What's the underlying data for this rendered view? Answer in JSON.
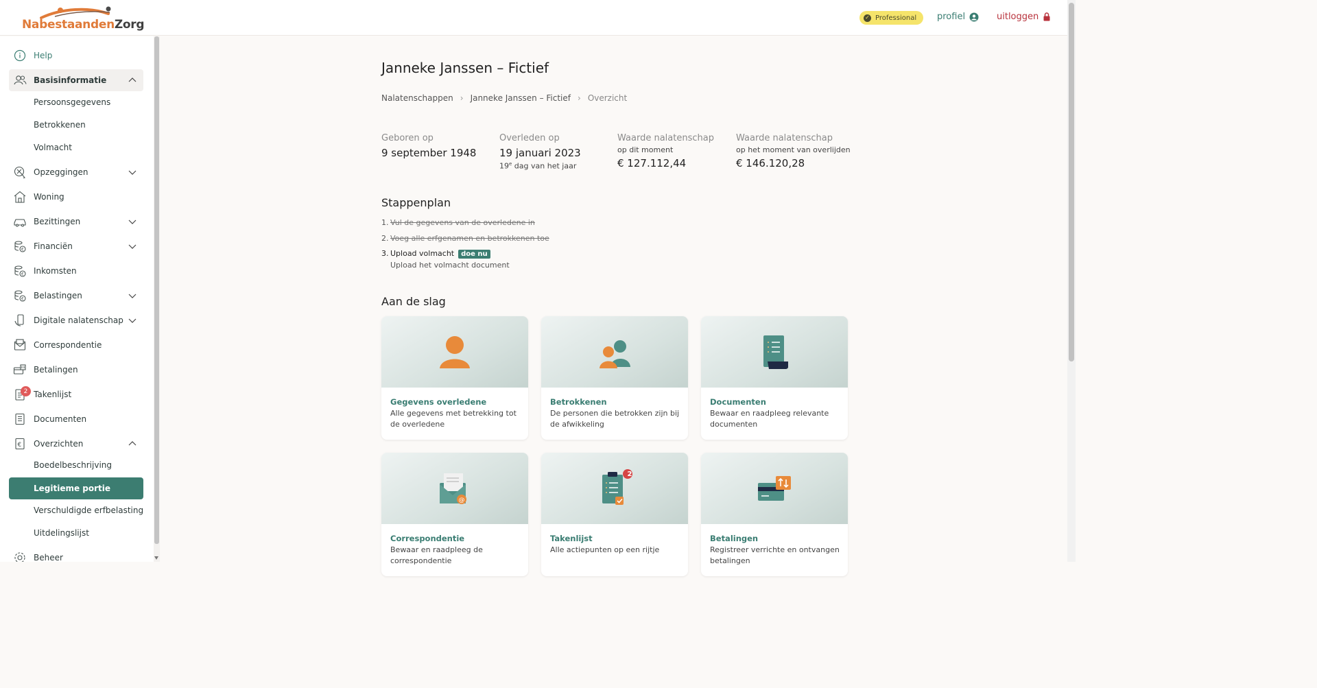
{
  "brand": {
    "logo_part1": "Nabestaanden",
    "logo_part2": "Zorg"
  },
  "header": {
    "plan_badge": "Professional",
    "profile_label": "profiel",
    "logout_label": "uitloggen"
  },
  "sidebar": {
    "help": "Help",
    "basisinformatie": "Basisinformatie",
    "basis_sub": [
      "Persoonsgegevens",
      "Betrokkenen",
      "Volmacht"
    ],
    "opzeggingen": "Opzeggingen",
    "woning": "Woning",
    "bezittingen": "Bezittingen",
    "financien": "Financiën",
    "inkomsten": "Inkomsten",
    "belastingen": "Belastingen",
    "digitale": "Digitale nalatenschap",
    "correspondentie": "Correspondentie",
    "betalingen": "Betalingen",
    "takenlijst": "Takenlijst",
    "takenlijst_count": "2",
    "documenten": "Documenten",
    "overzichten": "Overzichten",
    "overzichten_sub": [
      "Boedelbeschrijving",
      "Legitieme portie",
      "Verschuldigde erfbelasting",
      "Uitdelingslijst"
    ],
    "beheer": "Beheer"
  },
  "main": {
    "title": "Janneke Janssen – Fictief",
    "breadcrumb": [
      "Nalatenschappen",
      "Janneke Janssen – Fictief",
      "Overzicht"
    ],
    "facts": {
      "born_label": "Geboren op",
      "born_value": "9 september 1948",
      "died_label": "Overleden op",
      "died_value": "19 januari 2023",
      "died_note_num": "19",
      "died_note_sup": "e",
      "died_note_rest": " dag van het jaar",
      "value_now_label": "Waarde nalatenschap",
      "value_now_sub": "op dit moment",
      "value_now": "€ 127.112,44",
      "value_death_label": "Waarde nalatenschap",
      "value_death_sub": "op het moment van overlijden",
      "value_death": "€ 146.120,28"
    },
    "stappenplan_title": "Stappenplan",
    "steps": [
      {
        "num": "1.",
        "text": "Vul de gegevens van de overledene in"
      },
      {
        "num": "2.",
        "text": "Voeg alle erfgenamen en betrokkenen toe"
      },
      {
        "num": "3.",
        "text": "Upload volmacht",
        "action": "doe nu",
        "sub": "Upload het volmacht document"
      }
    ],
    "aan_de_slag_title": "Aan de slag",
    "cards": [
      {
        "title": "Gegevens overledene",
        "desc": "Alle gegevens met betrekking tot de overledene"
      },
      {
        "title": "Betrokkenen",
        "desc": "De personen die betrokken zijn bij de afwikkeling"
      },
      {
        "title": "Documenten",
        "desc": "Bewaar en raadpleeg relevante documenten"
      },
      {
        "title": "Correspondentie",
        "desc": "Bewaar en raadpleeg de correspondentie"
      },
      {
        "title": "Takenlijst",
        "desc": "Alle actiepunten op een rijtje",
        "badge": "2"
      },
      {
        "title": "Betalingen",
        "desc": "Registreer verrichte en ontvangen betalingen"
      }
    ]
  },
  "colors": {
    "primary": "#3c7d71",
    "accent": "#e88a3a",
    "badge_yellow": "#f5e46b",
    "logout_red": "#b8323c"
  }
}
